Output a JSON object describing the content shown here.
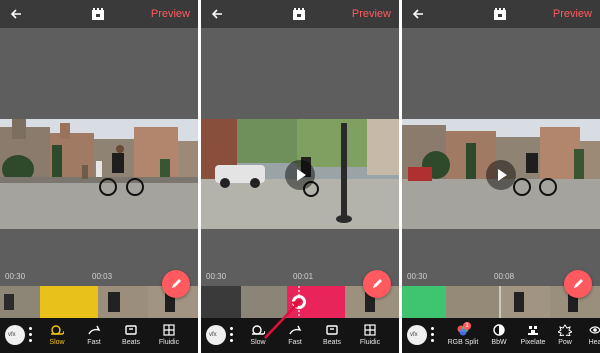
{
  "panels": [
    {
      "preview_label": "Preview",
      "time_start": "00:30",
      "time_current": "00:03",
      "tools": [
        "Slow",
        "Fast",
        "Beats",
        "Fluidic"
      ],
      "active_tool": "Slow"
    },
    {
      "preview_label": "Preview",
      "time_start": "00:30",
      "time_current": "00:01",
      "tools": [
        "Slow",
        "Fast",
        "Beats",
        "Fluidic"
      ],
      "active_tool": "none"
    },
    {
      "preview_label": "Preview",
      "time_start": "00:30",
      "time_current": "00:08",
      "tools": [
        "RGB Split",
        "BbW",
        "Pixelate",
        "Pow",
        "Hea"
      ],
      "rgb_badge": "1"
    }
  ],
  "toggle_label": "vfx",
  "icons": {
    "back": "arrow-left-icon",
    "logo": "app-logo-icon",
    "edit": "pencil-icon",
    "play": "play-icon",
    "menu": "kebab-menu-icon"
  },
  "colors": {
    "accent": "#ff5a5f",
    "active": "#f5c518",
    "slow_segment": "#e8c21a",
    "selected_segment": "#e8245a",
    "green_segment": "#3fc56f"
  }
}
